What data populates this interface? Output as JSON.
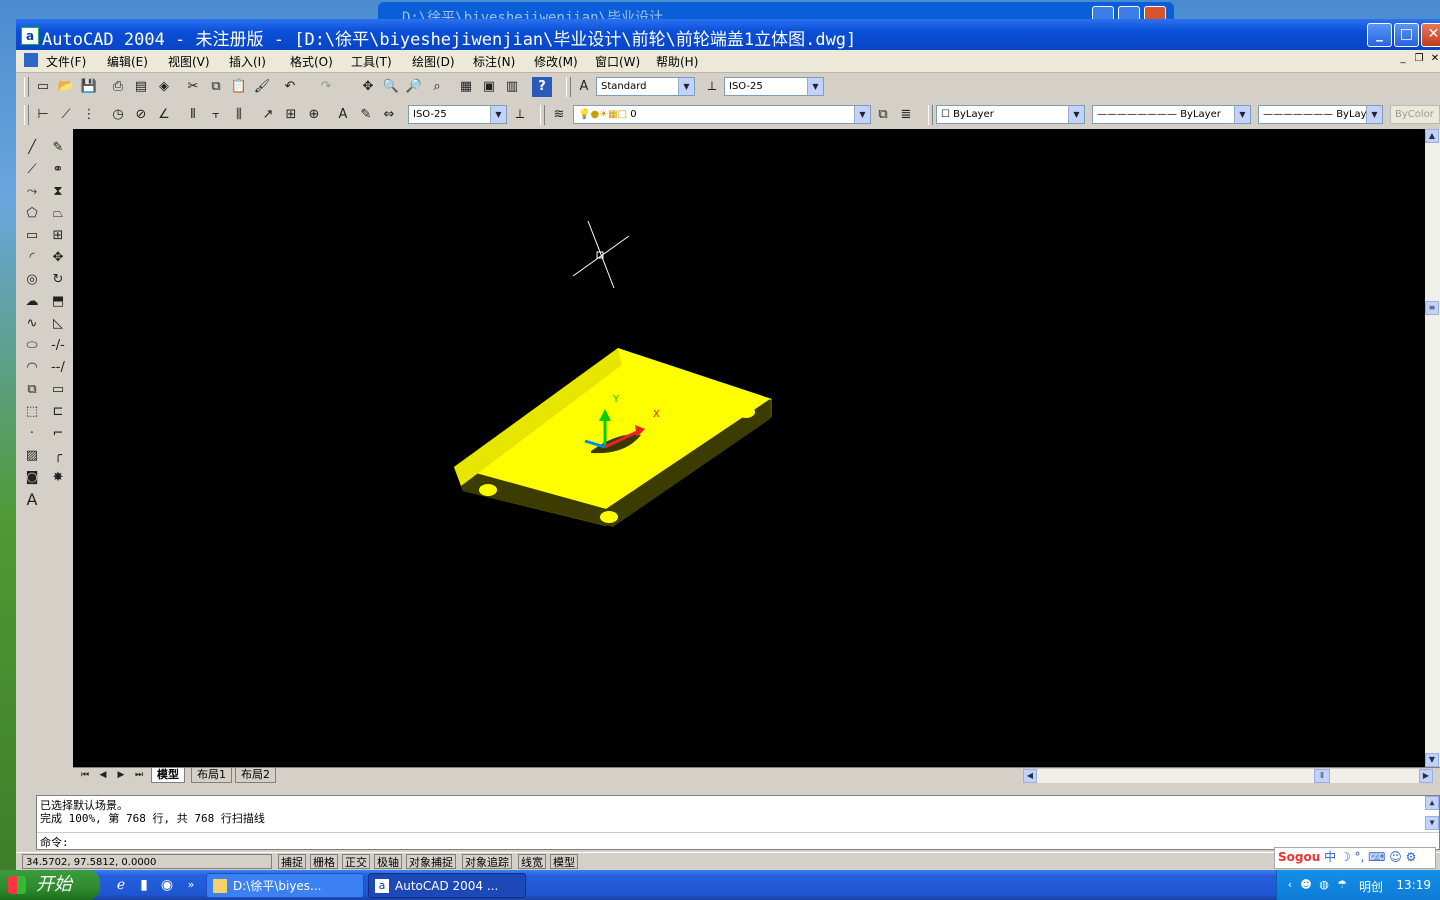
{
  "background_window": {
    "title": "D:\\徐平\\biyeshejiwenjian\\毕业设计"
  },
  "window": {
    "title": "AutoCAD 2004 - 未注册版 - [D:\\徐平\\biyeshejiwenjian\\毕业设计\\前轮\\前轮端盖1立体图.dwg]",
    "minimize": "_",
    "maximize": "□",
    "close": "✕"
  },
  "menu": {
    "items": [
      "文件(F)",
      "编辑(E)",
      "视图(V)",
      "插入(I)",
      "格式(O)",
      "工具(T)",
      "绘图(D)",
      "标注(N)",
      "修改(M)",
      "窗口(W)",
      "帮助(H)"
    ],
    "mdi": [
      "_",
      "❐",
      "✕"
    ]
  },
  "toolbar": {
    "text_style": "Standard",
    "dim_style": "ISO-25",
    "dim_style2": "ISO-25",
    "layer": "0",
    "color": "ByLayer",
    "linetype": "ByLayer",
    "lineweight": "ByLayer",
    "plotstyle": "ByColor"
  },
  "tabs": [
    "模型",
    "布局1",
    "布局2"
  ],
  "command": {
    "line1": "已选择默认场景。",
    "line2": "完成 100%, 第 768 行, 共 768 行扫描线",
    "prompt": "命令:"
  },
  "status": {
    "coords": "34.5702,  97.5812, 0.0000",
    "toggles": [
      "捕捉",
      "栅格",
      "正交",
      "极轴",
      "对象捕捉",
      "对象追踪",
      "线宽",
      "模型"
    ]
  },
  "ucs": {
    "x": "X",
    "y": "Y"
  },
  "sogou": {
    "brand": "Sogou",
    "mode": "中"
  },
  "taskbar": {
    "start": "开始",
    "tasks": [
      "D:\\徐平\\biyes...",
      "AutoCAD 2004 ..."
    ],
    "ime": "明创",
    "clock": "13:19"
  },
  "colors": {
    "model_face": "#ffff00",
    "model_side": "#b5b500",
    "model_dark": "#3a3a00",
    "viewport_bg": "#000000"
  }
}
